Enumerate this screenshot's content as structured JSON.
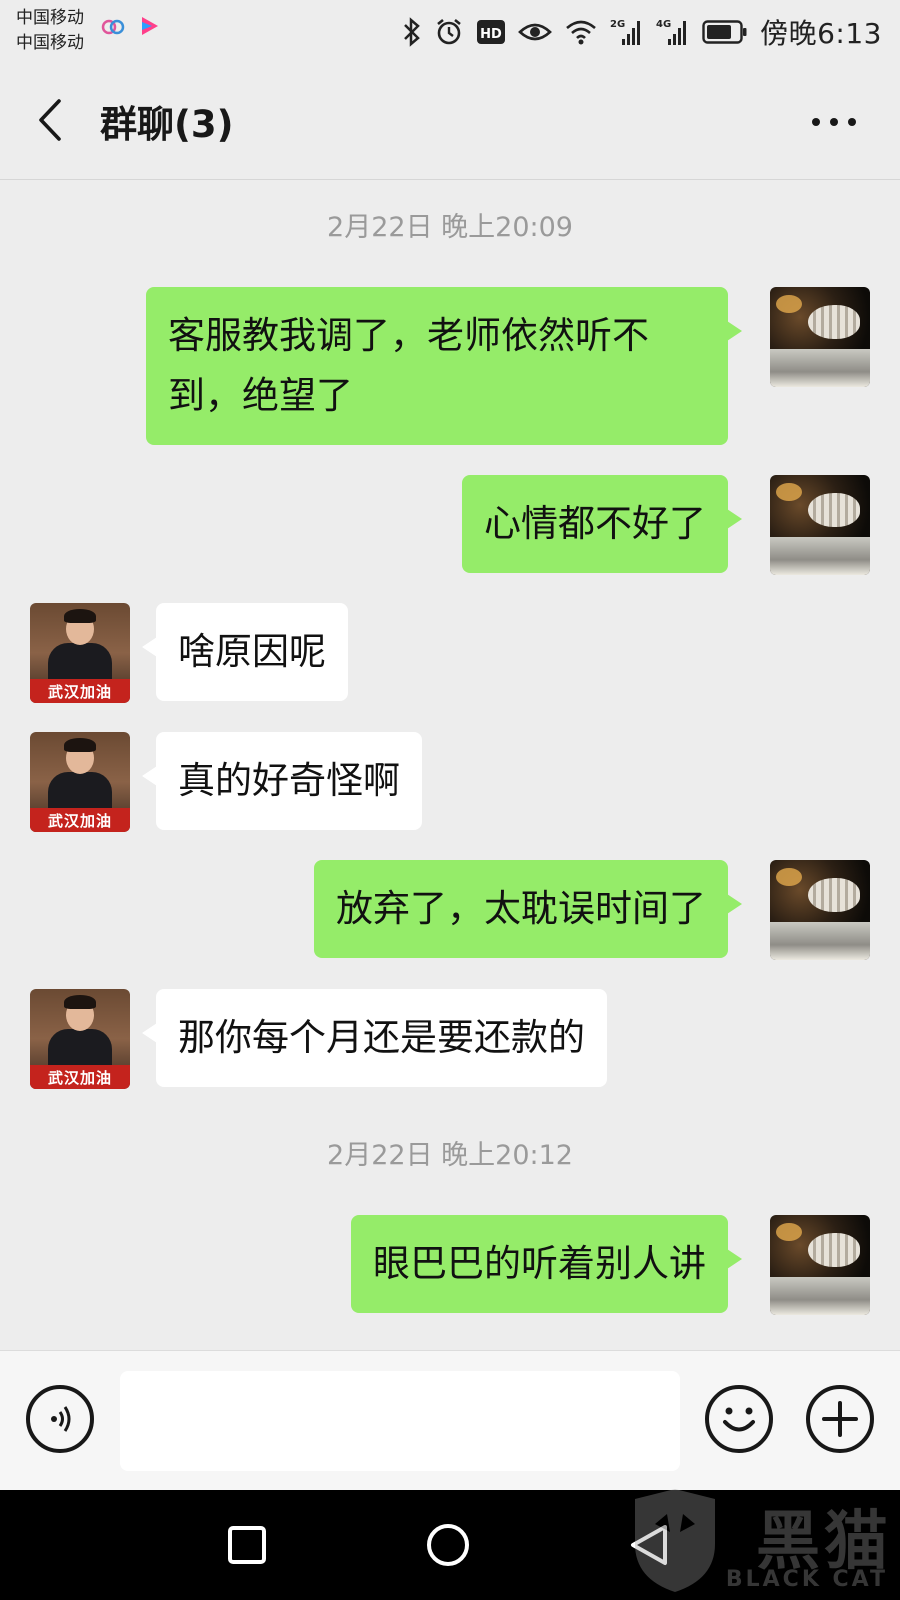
{
  "status_bar": {
    "carrier_1": "中国移动",
    "carrier_2": "中国移动",
    "app_icon_1": "app-icon",
    "app_icon_2": "YOUKU",
    "signal_2g": "2G",
    "signal_4g": "4G",
    "hd": "HD",
    "time": "傍晚6:13"
  },
  "header": {
    "title": "群聊(3)"
  },
  "messages": [
    {
      "type": "timestamp",
      "text": "2月22日 晚上20:09"
    },
    {
      "type": "sent",
      "text": "客服教我调了，老师依然听不到，绝望了"
    },
    {
      "type": "sent",
      "text": "心情都不好了"
    },
    {
      "type": "received",
      "text": "啥原因呢"
    },
    {
      "type": "received",
      "text": "真的好奇怪啊"
    },
    {
      "type": "sent",
      "text": "放弃了，太耽误时间了"
    },
    {
      "type": "received",
      "text": "那你每个月还是要还款的"
    },
    {
      "type": "timestamp",
      "text": "2月22日 晚上20:12"
    },
    {
      "type": "sent",
      "text": "眼巴巴的听着别人讲"
    }
  ],
  "avatar_banner": "武汉加油",
  "input": {
    "placeholder": ""
  },
  "watermark": {
    "cn": "黑猫",
    "en": "BLACK CAT"
  },
  "colors": {
    "background": "#ededed",
    "sent_bubble": "#95ec69",
    "received_bubble": "#ffffff",
    "timestamp": "#9a9a9a",
    "navbar": "#000000"
  }
}
